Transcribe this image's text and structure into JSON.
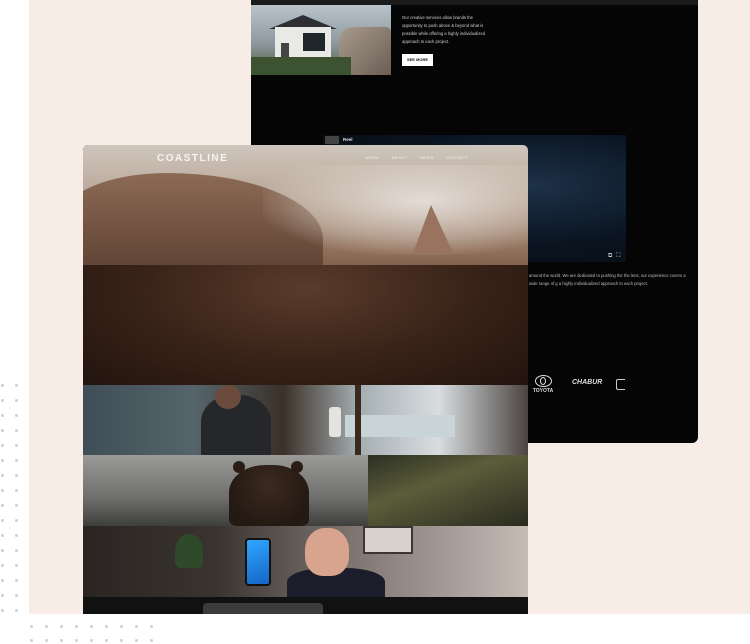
{
  "back_page": {
    "about_text": "Our creative services allow brands the opportunity to push above & beyond what is possible while offering a highly individualized approach to each project.",
    "see_more_label": "SEE MORE",
    "video": {
      "title": "Reel",
      "controls": [
        "⧉",
        "⛶"
      ]
    },
    "side_text": "around the world. We are dedicated to pushing the the lens, our experience covers a wide range of g a highly individualized approach to each project.",
    "clients": {
      "toyota": "TOYOTA",
      "chabur": "CHABUR"
    }
  },
  "front_page": {
    "logo": "COASTLINE",
    "nav": [
      "WORK",
      "ABOUT",
      "NEWS",
      "CONTACT"
    ]
  }
}
